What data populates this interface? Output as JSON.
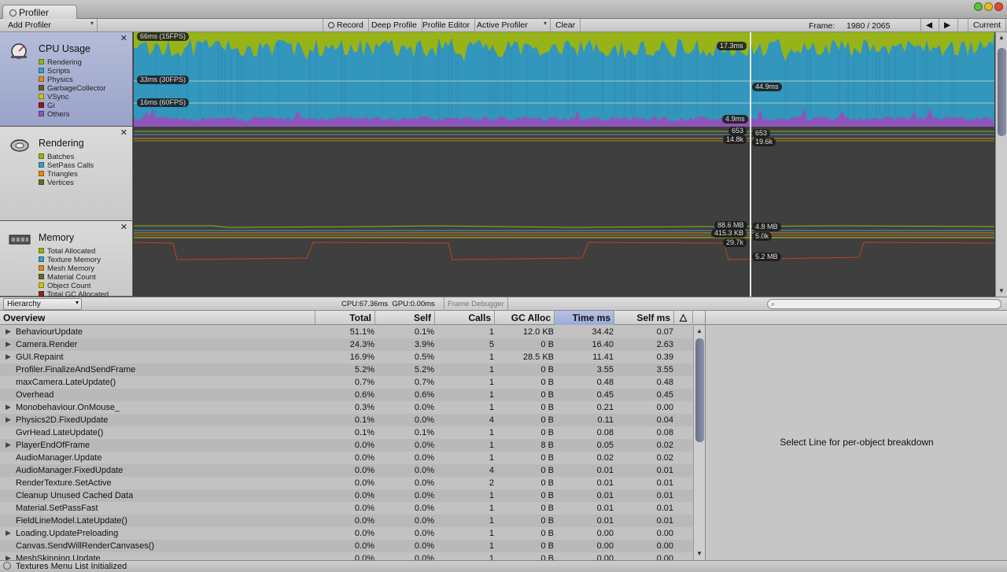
{
  "window": {
    "tab_title": "Profiler"
  },
  "toolbar": {
    "add_profiler": "Add Profiler",
    "record": "Record",
    "deep_profile": "Deep Profile",
    "profile_editor": "Profile Editor",
    "active_profiler": "Active Profiler",
    "clear": "Clear",
    "frame_label": "Frame:",
    "frame_value": "1980 / 2065",
    "prev_icon": "◀",
    "next_icon": "▶",
    "current": "Current"
  },
  "modules": {
    "cpu": {
      "title": "CPU Usage",
      "legend": [
        {
          "label": "Rendering",
          "color": "#8fb517"
        },
        {
          "label": "Scripts",
          "color": "#3e9dc4"
        },
        {
          "label": "Physics",
          "color": "#e08a1e"
        },
        {
          "label": "GarbageCollector",
          "color": "#6b5a2c"
        },
        {
          "label": "VSync",
          "color": "#d2c013"
        },
        {
          "label": "Gi",
          "color": "#8b1e1e"
        },
        {
          "label": "Others",
          "color": "#8a55b3"
        }
      ],
      "markers": {
        "fps15": "66ms (15FPS)",
        "fps30": "33ms (30FPS)",
        "fps60": "16ms (60FPS)"
      },
      "selection_labels": {
        "a": "17.3ms",
        "b": "44.9ms",
        "c": "4.9ms"
      }
    },
    "rendering": {
      "title": "Rendering",
      "legend": [
        {
          "label": "Batches",
          "color": "#8fb517"
        },
        {
          "label": "SetPass Calls",
          "color": "#3e9dc4"
        },
        {
          "label": "Triangles",
          "color": "#e08a1e"
        },
        {
          "label": "Vertices",
          "color": "#6b6a1c"
        }
      ],
      "selection_labels": {
        "a": "653",
        "b": "653",
        "c": "14.8k",
        "d": "19.6k"
      }
    },
    "memory": {
      "title": "Memory",
      "legend": [
        {
          "label": "Total Allocated",
          "color": "#8fb517"
        },
        {
          "label": "Texture Memory",
          "color": "#3e9dc4"
        },
        {
          "label": "Mesh Memory",
          "color": "#e08a1e"
        },
        {
          "label": "Material Count",
          "color": "#6b6a1c"
        },
        {
          "label": "Object Count",
          "color": "#d2c013"
        },
        {
          "label": "Total GC Allocated",
          "color": "#8b2a14"
        }
      ],
      "selection_labels": {
        "a": "88.6 MB",
        "b": "4.8 MB",
        "c": "415.3 KB",
        "d": "5.0k",
        "e": "29.7k",
        "f": "5.2 MB"
      }
    }
  },
  "detail_toolbar": {
    "view_mode": "Hierarchy",
    "cpu_info": "CPU:67.36ms",
    "gpu_info": "GPU:0.00ms",
    "frame_debugger": "Frame Debugger",
    "search_placeholder": ""
  },
  "table": {
    "columns": [
      "Overview",
      "Total",
      "Self",
      "Calls",
      "GC Alloc",
      "Time ms",
      "Self ms"
    ],
    "sorted_column": "Time ms",
    "rows": [
      {
        "name": "BehaviourUpdate",
        "expandable": true,
        "total": "51.1%",
        "self": "0.1%",
        "calls": "1",
        "gc": "12.0 KB",
        "time": "34.42",
        "selfms": "0.07"
      },
      {
        "name": "Camera.Render",
        "expandable": true,
        "total": "24.3%",
        "self": "3.9%",
        "calls": "5",
        "gc": "0 B",
        "time": "16.40",
        "selfms": "2.63"
      },
      {
        "name": "GUI.Repaint",
        "expandable": true,
        "total": "16.9%",
        "self": "0.5%",
        "calls": "1",
        "gc": "28.5 KB",
        "time": "11.41",
        "selfms": "0.39"
      },
      {
        "name": "Profiler.FinalizeAndSendFrame",
        "expandable": false,
        "total": "5.2%",
        "self": "5.2%",
        "calls": "1",
        "gc": "0 B",
        "time": "3.55",
        "selfms": "3.55"
      },
      {
        "name": "maxCamera.LateUpdate()",
        "expandable": false,
        "total": "0.7%",
        "self": "0.7%",
        "calls": "1",
        "gc": "0 B",
        "time": "0.48",
        "selfms": "0.48"
      },
      {
        "name": "Overhead",
        "expandable": false,
        "total": "0.6%",
        "self": "0.6%",
        "calls": "1",
        "gc": "0 B",
        "time": "0.45",
        "selfms": "0.45"
      },
      {
        "name": "Monobehaviour.OnMouse_",
        "expandable": true,
        "total": "0.3%",
        "self": "0.0%",
        "calls": "1",
        "gc": "0 B",
        "time": "0.21",
        "selfms": "0.00"
      },
      {
        "name": "Physics2D.FixedUpdate",
        "expandable": true,
        "total": "0.1%",
        "self": "0.0%",
        "calls": "4",
        "gc": "0 B",
        "time": "0.11",
        "selfms": "0.04"
      },
      {
        "name": "GvrHead.LateUpdate()",
        "expandable": false,
        "total": "0.1%",
        "self": "0.1%",
        "calls": "1",
        "gc": "0 B",
        "time": "0.08",
        "selfms": "0.08"
      },
      {
        "name": "PlayerEndOfFrame",
        "expandable": true,
        "total": "0.0%",
        "self": "0.0%",
        "calls": "1",
        "gc": "8 B",
        "time": "0.05",
        "selfms": "0.02"
      },
      {
        "name": "AudioManager.Update",
        "expandable": false,
        "total": "0.0%",
        "self": "0.0%",
        "calls": "1",
        "gc": "0 B",
        "time": "0.02",
        "selfms": "0.02"
      },
      {
        "name": "AudioManager.FixedUpdate",
        "expandable": false,
        "total": "0.0%",
        "self": "0.0%",
        "calls": "4",
        "gc": "0 B",
        "time": "0.01",
        "selfms": "0.01"
      },
      {
        "name": "RenderTexture.SetActive",
        "expandable": false,
        "total": "0.0%",
        "self": "0.0%",
        "calls": "2",
        "gc": "0 B",
        "time": "0.01",
        "selfms": "0.01"
      },
      {
        "name": "Cleanup Unused Cached Data",
        "expandable": false,
        "total": "0.0%",
        "self": "0.0%",
        "calls": "1",
        "gc": "0 B",
        "time": "0.01",
        "selfms": "0.01"
      },
      {
        "name": "Material.SetPassFast",
        "expandable": false,
        "total": "0.0%",
        "self": "0.0%",
        "calls": "1",
        "gc": "0 B",
        "time": "0.01",
        "selfms": "0.01"
      },
      {
        "name": "FieldLineModel.LateUpdate()",
        "expandable": false,
        "total": "0.0%",
        "self": "0.0%",
        "calls": "1",
        "gc": "0 B",
        "time": "0.01",
        "selfms": "0.01"
      },
      {
        "name": "Loading.UpdatePreloading",
        "expandable": true,
        "total": "0.0%",
        "self": "0.0%",
        "calls": "1",
        "gc": "0 B",
        "time": "0.00",
        "selfms": "0.00"
      },
      {
        "name": "Canvas.SendWillRenderCanvases()",
        "expandable": false,
        "total": "0.0%",
        "self": "0.0%",
        "calls": "1",
        "gc": "0 B",
        "time": "0.00",
        "selfms": "0.00"
      },
      {
        "name": "MeshSkinning.Update",
        "expandable": true,
        "total": "0.0%",
        "self": "0.0%",
        "calls": "1",
        "gc": "0 B",
        "time": "0.00",
        "selfms": "0.00"
      }
    ]
  },
  "right_pane": {
    "message": "Select Line for per-object breakdown"
  },
  "status": {
    "message": "Textures Menu List Initialized"
  }
}
